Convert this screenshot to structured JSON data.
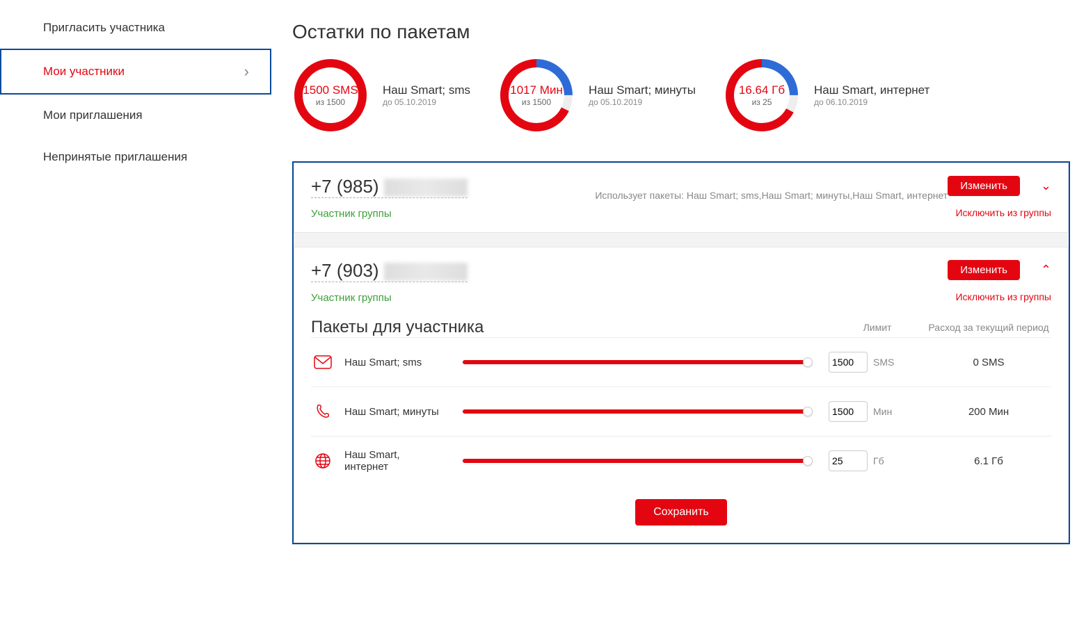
{
  "sidebar": {
    "items": [
      {
        "label": "Пригласить участника",
        "active": false
      },
      {
        "label": "Мои участники",
        "active": true
      },
      {
        "label": "Мои приглашения",
        "active": false
      },
      {
        "label": "Непринятые приглашения",
        "active": false
      }
    ]
  },
  "remainders": {
    "title": "Остатки по пакетам",
    "items": [
      {
        "value": "1500 SMS",
        "sub": "из 1500",
        "name": "Наш Smart; sms",
        "date": "до 05.10.2019",
        "pct": 100
      },
      {
        "value": "1017 Мин",
        "sub": "из 1500",
        "name": "Наш Smart; минуты",
        "date": "до 05.10.2019",
        "pct": 68
      },
      {
        "value": "16.64 Гб",
        "sub": "из 25",
        "name": "Наш Smart, интернет",
        "date": "до 06.10.2019",
        "pct": 67
      }
    ]
  },
  "members": [
    {
      "phone_prefix": "+7 (985)",
      "role": "Участник группы",
      "uses": "Использует пакеты: Наш Smart; sms,Наш Smart; минуты,Наш Smart, интернет",
      "edit_label": "Изменить",
      "exclude_label": "Исключить из группы",
      "expanded": false
    },
    {
      "phone_prefix": "+7 (903)",
      "role": "Участник группы",
      "edit_label": "Изменить",
      "exclude_label": "Исключить из группы",
      "expanded": true,
      "packages_title": "Пакеты для участника",
      "col_limit": "Лимит",
      "col_spend": "Расход за текущий период",
      "packages": [
        {
          "name": "Наш Smart; sms",
          "limit": "1500",
          "unit": "SMS",
          "spend": "0 SMS",
          "pct": 100
        },
        {
          "name": "Наш Smart; минуты",
          "limit": "1500",
          "unit": "Мин",
          "spend": "200 Мин",
          "pct": 100
        },
        {
          "name": "Наш Smart, интернет",
          "limit": "25",
          "unit": "Гб",
          "spend": "6.1 Гб",
          "pct": 100
        }
      ],
      "save_label": "Сохранить"
    }
  ],
  "colors": {
    "accent": "#e30611",
    "frame": "#0a4b9a"
  }
}
